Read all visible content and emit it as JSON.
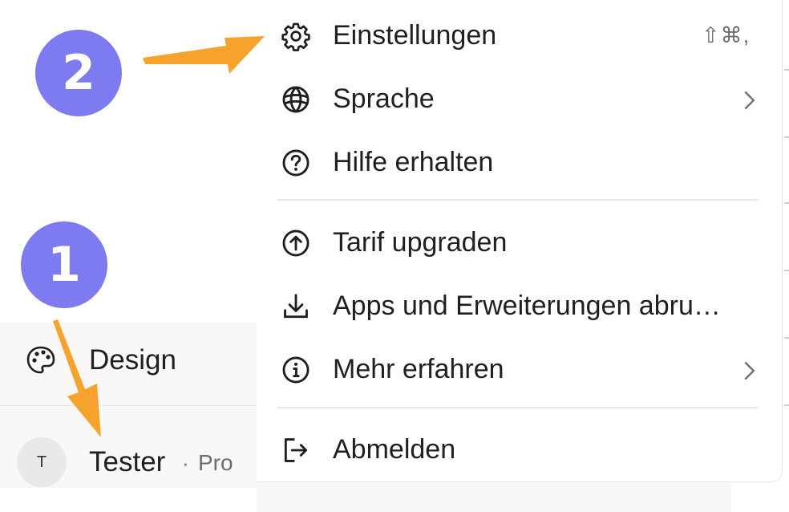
{
  "sidebar": {
    "design": {
      "label": "Design",
      "icon": "palette-icon"
    },
    "user": {
      "avatar_initial": "T",
      "name": "Tester",
      "separator": "·",
      "plan": "Pro"
    }
  },
  "menu": {
    "items": [
      {
        "label": "Einstellungen",
        "icon": "gear-icon",
        "shortcut": "⇧⌘,"
      },
      {
        "label": "Sprache",
        "icon": "globe-icon",
        "submenu": true
      },
      {
        "label": "Hilfe erhalten",
        "icon": "help-circle-icon"
      },
      {
        "label": "Tarif upgraden",
        "icon": "upgrade-circle-icon"
      },
      {
        "label": "Apps und Erweiterungen abru…",
        "icon": "download-icon"
      },
      {
        "label": "Mehr erfahren",
        "icon": "info-circle-icon",
        "submenu": true
      },
      {
        "label": "Abmelden",
        "icon": "logout-icon"
      }
    ]
  },
  "annotations": {
    "step1": "1",
    "step2": "2",
    "color": "#7d7bef",
    "arrow_color": "#f5a32c"
  }
}
